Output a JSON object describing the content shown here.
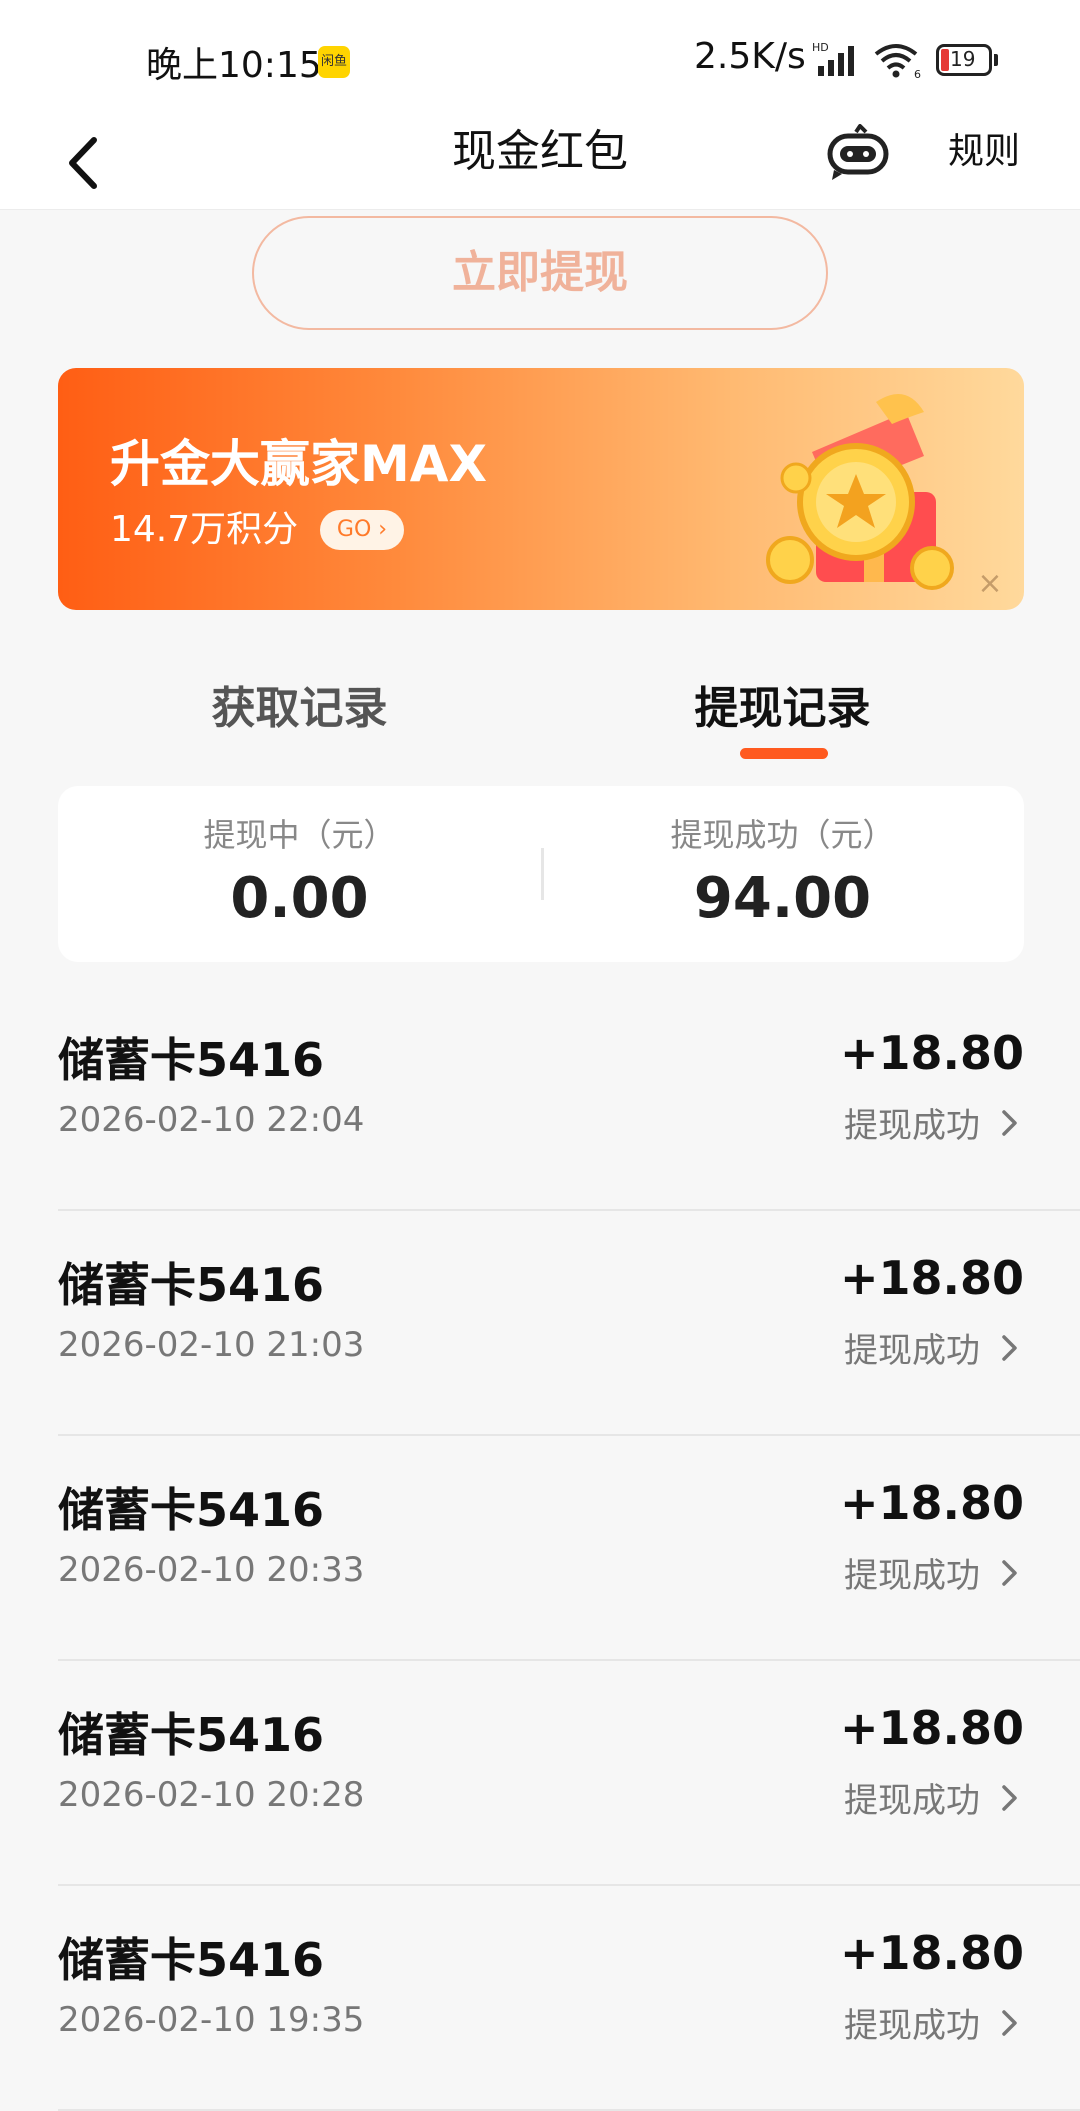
{
  "status_bar": {
    "time": "晚上10:15",
    "app_badge": "闲鱼",
    "net_speed": "2.5K/s",
    "battery": "19",
    "icons": [
      "signal-icon",
      "wifi-icon",
      "battery-icon"
    ]
  },
  "nav": {
    "title": "现金红包",
    "rules": "规则",
    "icons": [
      "back-arrow-icon",
      "robot-assistant-icon"
    ]
  },
  "withdraw_button": "立即提现",
  "promo": {
    "title": "升金大赢家MAX",
    "points": "14.7万积分",
    "go": "GO ›",
    "close": "×",
    "icon": "gift-box-coins-icon"
  },
  "tabs": [
    {
      "label": "获取记录",
      "active": false
    },
    {
      "label": "提现记录",
      "active": true
    }
  ],
  "summary": {
    "pending_label": "提现中（元）",
    "pending_value": "0.00",
    "success_label": "提现成功（元）",
    "success_value": "94.00"
  },
  "records": [
    {
      "title": "储蓄卡5416",
      "time": "2026-02-10 22:04",
      "amount": "+18.80",
      "status": "提现成功"
    },
    {
      "title": "储蓄卡5416",
      "time": "2026-02-10 21:03",
      "amount": "+18.80",
      "status": "提现成功"
    },
    {
      "title": "储蓄卡5416",
      "time": "2026-02-10 20:33",
      "amount": "+18.80",
      "status": "提现成功"
    },
    {
      "title": "储蓄卡5416",
      "time": "2026-02-10 20:28",
      "amount": "+18.80",
      "status": "提现成功"
    },
    {
      "title": "储蓄卡5416",
      "time": "2026-02-10 19:35",
      "amount": "+18.80",
      "status": "提现成功"
    }
  ],
  "colors": {
    "accent": "#ff5a1f",
    "withdraw_text": "#f0b29a",
    "background": "#f7f7f7"
  }
}
